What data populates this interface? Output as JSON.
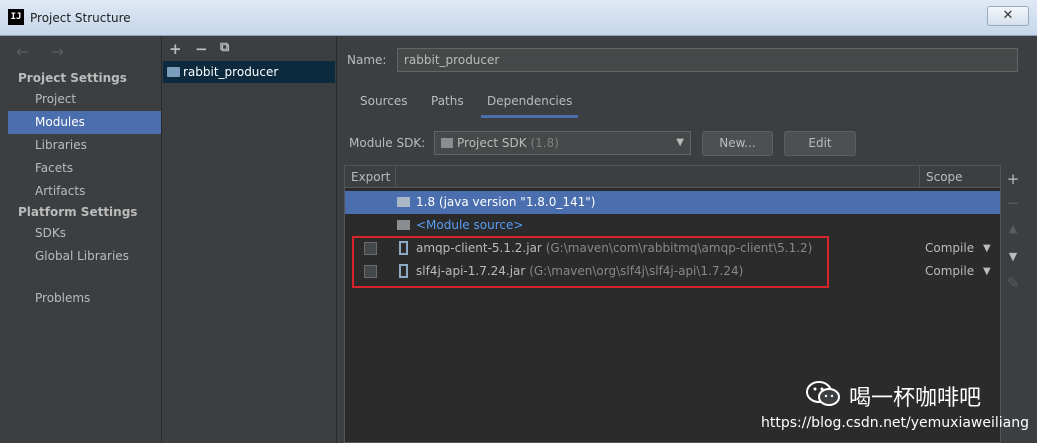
{
  "window": {
    "title": "Project Structure",
    "app_icon": "IJ",
    "close_label": "✕"
  },
  "nav": {
    "back_forward": "← →",
    "project_settings_header": "Project Settings",
    "platform_settings_header": "Platform Settings",
    "items": [
      {
        "label": "Project"
      },
      {
        "label": "Modules"
      },
      {
        "label": "Libraries"
      },
      {
        "label": "Facets"
      },
      {
        "label": "Artifacts"
      },
      {
        "label": "SDKs"
      },
      {
        "label": "Global Libraries"
      },
      {
        "label": "Problems"
      }
    ],
    "selected": "Modules"
  },
  "module_toolbar": {
    "add": "+",
    "remove": "−",
    "copy": "⧉"
  },
  "modules": [
    {
      "name": "rabbit_producer"
    }
  ],
  "detail": {
    "name_label": "Name:",
    "name_value": "rabbit_producer",
    "tabs": [
      {
        "label": "Sources"
      },
      {
        "label": "Paths"
      },
      {
        "label": "Dependencies"
      }
    ],
    "active_tab": "Dependencies",
    "sdk_label": "Module SDK:",
    "sdk_value": "Project SDK",
    "sdk_version": "(1.8)",
    "new_button": "New...",
    "edit_button": "Edit"
  },
  "dependencies": {
    "columns": {
      "export": "Export",
      "scope": "Scope"
    },
    "rows": [
      {
        "name": "1.8 (java version \"1.8.0_141\")",
        "kind": "sdk",
        "selected": true
      },
      {
        "name": "<Module source>",
        "kind": "source"
      },
      {
        "name": "amqp-client-5.1.2.jar",
        "path": "(G:\\maven\\com\\rabbitmq\\amqp-client\\5.1.2)",
        "scope": "Compile",
        "kind": "jar"
      },
      {
        "name": "slf4j-api-1.7.24.jar",
        "path": "(G:\\maven\\org\\slf4j\\slf4j-api\\1.7.24)",
        "scope": "Compile",
        "kind": "jar"
      }
    ]
  },
  "side_tools": {
    "add": "+",
    "remove": "−",
    "up": "▲",
    "down": "▼",
    "edit": "✎"
  },
  "watermark": {
    "name": "喝一杯咖啡吧",
    "url": "https://blog.csdn.net/yemuxiaweiliang"
  },
  "colors": {
    "selection": "#4b6eaf",
    "highlight_box": "#d6252b",
    "link": "#589df6"
  }
}
